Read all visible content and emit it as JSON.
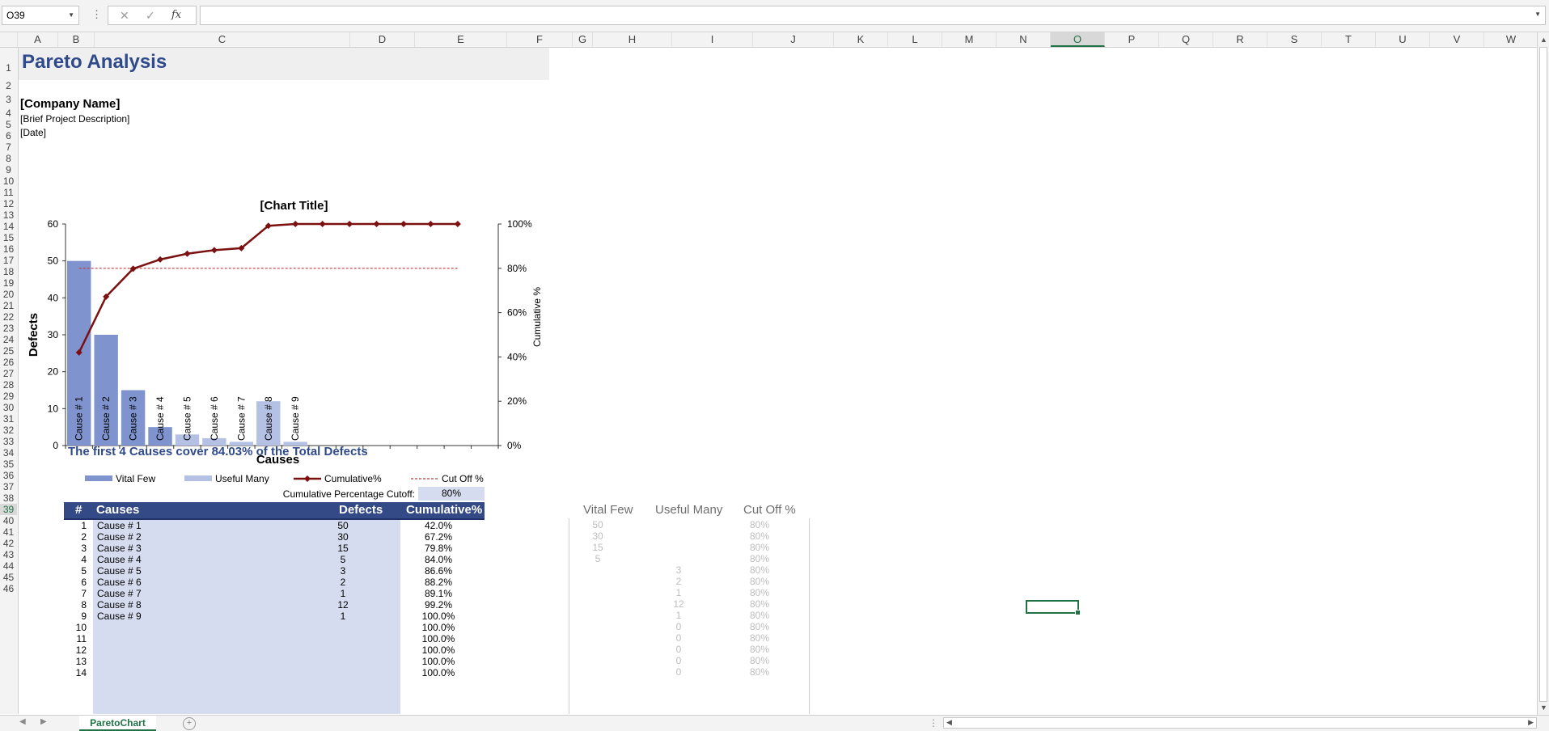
{
  "formula_bar": {
    "name_box": "O39",
    "fx": "fx",
    "formula": ""
  },
  "columns": [
    {
      "label": "A",
      "w": 50
    },
    {
      "label": "B",
      "w": 45
    },
    {
      "label": "C",
      "w": 316
    },
    {
      "label": "D",
      "w": 80
    },
    {
      "label": "E",
      "w": 114
    },
    {
      "label": "F",
      "w": 81
    },
    {
      "label": "G",
      "w": 25
    },
    {
      "label": "H",
      "w": 98
    },
    {
      "label": "I",
      "w": 100
    },
    {
      "label": "J",
      "w": 100
    },
    {
      "label": "K",
      "w": 67
    },
    {
      "label": "L",
      "w": 67
    },
    {
      "label": "M",
      "w": 67
    },
    {
      "label": "N",
      "w": 67
    },
    {
      "label": "O",
      "w": 67
    },
    {
      "label": "P",
      "w": 67
    },
    {
      "label": "Q",
      "w": 67
    },
    {
      "label": "R",
      "w": 67
    },
    {
      "label": "S",
      "w": 67
    },
    {
      "label": "T",
      "w": 67
    },
    {
      "label": "U",
      "w": 67
    },
    {
      "label": "V",
      "w": 67
    },
    {
      "label": "W",
      "w": 67
    }
  ],
  "selected_column": "O",
  "selected_row": "39",
  "sheet": {
    "title": "Pareto Analysis",
    "company": "[Company Name]",
    "description": "[Brief Project Description]",
    "date": "[Date]",
    "summary": "The first 4 Causes cover 84.03% of the Total Defects",
    "cutoff_label": "Cumulative Percentage Cutoff:",
    "cutoff_value": "80%"
  },
  "table": {
    "headers": [
      "#",
      "Causes",
      "Defects",
      "Cumulative%"
    ],
    "rows": [
      {
        "n": "1",
        "cause": "Cause # 1",
        "defects": "50",
        "cum": "42.0%"
      },
      {
        "n": "2",
        "cause": "Cause # 2",
        "defects": "30",
        "cum": "67.2%"
      },
      {
        "n": "3",
        "cause": "Cause # 3",
        "defects": "15",
        "cum": "79.8%"
      },
      {
        "n": "4",
        "cause": "Cause # 4",
        "defects": "5",
        "cum": "84.0%"
      },
      {
        "n": "5",
        "cause": "Cause # 5",
        "defects": "3",
        "cum": "86.6%"
      },
      {
        "n": "6",
        "cause": "Cause # 6",
        "defects": "2",
        "cum": "88.2%"
      },
      {
        "n": "7",
        "cause": "Cause # 7",
        "defects": "1",
        "cum": "89.1%"
      },
      {
        "n": "8",
        "cause": "Cause # 8",
        "defects": "12",
        "cum": "99.2%"
      },
      {
        "n": "9",
        "cause": "Cause # 9",
        "defects": "1",
        "cum": "100.0%"
      },
      {
        "n": "10",
        "cause": "",
        "defects": "",
        "cum": "100.0%"
      },
      {
        "n": "11",
        "cause": "",
        "defects": "",
        "cum": "100.0%"
      },
      {
        "n": "12",
        "cause": "",
        "defects": "",
        "cum": "100.0%"
      },
      {
        "n": "13",
        "cause": "",
        "defects": "",
        "cum": "100.0%"
      },
      {
        "n": "14",
        "cause": "",
        "defects": "",
        "cum": "100.0%"
      }
    ]
  },
  "helper": {
    "headers": [
      "Vital Few",
      "Useful Many",
      "Cut Off %"
    ],
    "rows": [
      {
        "vf": "50",
        "um": "",
        "co": "80%"
      },
      {
        "vf": "30",
        "um": "",
        "co": "80%"
      },
      {
        "vf": "15",
        "um": "",
        "co": "80%"
      },
      {
        "vf": "5",
        "um": "",
        "co": "80%"
      },
      {
        "vf": "",
        "um": "3",
        "co": "80%"
      },
      {
        "vf": "",
        "um": "2",
        "co": "80%"
      },
      {
        "vf": "",
        "um": "1",
        "co": "80%"
      },
      {
        "vf": "",
        "um": "12",
        "co": "80%"
      },
      {
        "vf": "",
        "um": "1",
        "co": "80%"
      },
      {
        "vf": "",
        "um": "0",
        "co": "80%"
      },
      {
        "vf": "",
        "um": "0",
        "co": "80%"
      },
      {
        "vf": "",
        "um": "0",
        "co": "80%"
      },
      {
        "vf": "",
        "um": "0",
        "co": "80%"
      },
      {
        "vf": "",
        "um": "0",
        "co": "80%"
      }
    ]
  },
  "chart_data": {
    "type": "bar",
    "title": "[Chart Title]",
    "xlabel": "Causes",
    "ylabel": "Defects",
    "y2label": "Cumulative %",
    "ylim": [
      0,
      60
    ],
    "yticks": [
      "0",
      "10",
      "20",
      "30",
      "40",
      "50",
      "60"
    ],
    "y2lim": [
      0,
      100
    ],
    "y2ticks": [
      "0%",
      "20%",
      "40%",
      "60%",
      "80%",
      "100%"
    ],
    "categories": [
      "Cause # 1",
      "Cause # 2",
      "Cause # 3",
      "Cause # 4",
      "Cause # 5",
      "Cause # 6",
      "Cause # 7",
      "Cause # 8",
      "Cause # 9",
      "",
      "",
      "",
      "",
      "",
      ""
    ],
    "slots": 16,
    "series": [
      {
        "name": "Vital Few",
        "values": [
          50,
          30,
          15,
          5,
          null,
          null,
          null,
          null,
          null,
          null,
          null,
          null,
          null,
          null,
          null
        ],
        "color": "#7f93cf"
      },
      {
        "name": "Useful Many",
        "values": [
          null,
          null,
          null,
          null,
          3,
          2,
          1,
          12,
          1,
          0,
          0,
          0,
          0,
          0,
          0
        ],
        "color": "#b4c1e4"
      },
      {
        "name": "Cumulative%",
        "values": [
          42.0,
          67.2,
          79.8,
          84.0,
          86.6,
          88.2,
          89.1,
          99.2,
          100,
          100,
          100,
          100,
          100,
          100,
          100
        ],
        "color": "#7b1010"
      },
      {
        "name": "Cut Off %",
        "values": [
          80,
          80,
          80,
          80,
          80,
          80,
          80,
          80,
          80,
          80,
          80,
          80,
          80,
          80,
          80
        ],
        "color": "#c23b3b"
      }
    ],
    "legend_position": "bottom"
  },
  "tabs": {
    "active": "ParetoChart",
    "add": "+"
  }
}
